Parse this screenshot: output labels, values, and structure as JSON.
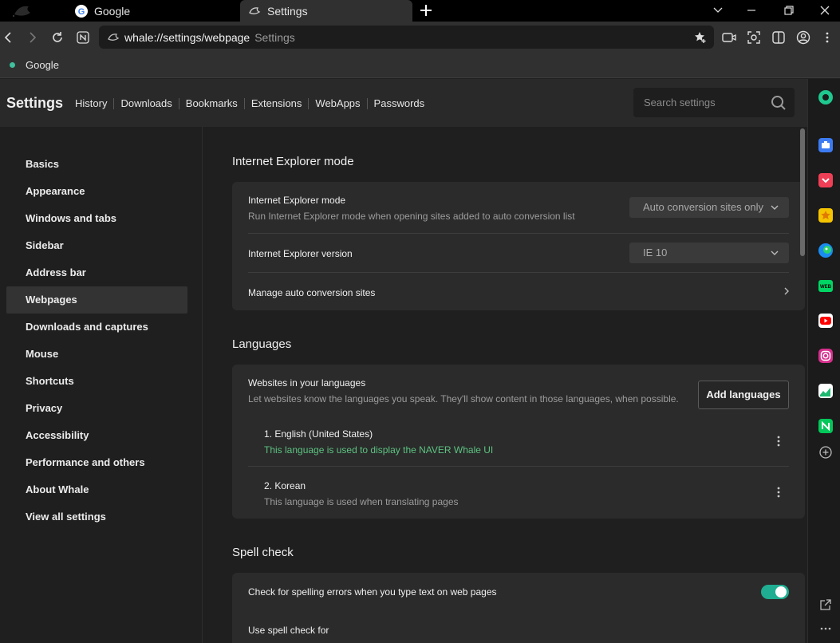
{
  "tabs": [
    {
      "title": "Google",
      "icon": "google-icon"
    },
    {
      "title": "Settings",
      "icon": "whale-icon"
    }
  ],
  "address": {
    "url": "whale://settings/webpage",
    "page_title": "Settings"
  },
  "bookmarks": [
    {
      "label": "Google"
    }
  ],
  "header": {
    "title": "Settings",
    "nav": [
      "History",
      "Downloads",
      "Bookmarks",
      "Extensions",
      "WebApps",
      "Passwords"
    ],
    "search_placeholder": "Search settings"
  },
  "sidebar": {
    "items": [
      "Basics",
      "Appearance",
      "Windows and tabs",
      "Sidebar",
      "Address bar",
      "Webpages",
      "Downloads and captures",
      "Mouse",
      "Shortcuts",
      "Privacy",
      "Accessibility",
      "Performance and others",
      "About Whale",
      "View all settings"
    ],
    "selected": "Webpages"
  },
  "ie_mode": {
    "section_title": "Internet Explorer mode",
    "mode_label": "Internet Explorer mode",
    "mode_desc": "Run Internet Explorer mode when opening sites added to auto conversion list",
    "mode_value": "Auto conversion sites only",
    "version_label": "Internet Explorer version",
    "version_value": "IE 10",
    "manage_label": "Manage auto conversion sites"
  },
  "languages": {
    "section_title": "Languages",
    "label": "Websites in your languages",
    "desc": "Let websites know the languages you speak. They'll show content in those languages, when possible.",
    "add_button": "Add languages",
    "list": [
      {
        "name": "1. English (United States)",
        "note": "This language is used to display the NAVER Whale UI"
      },
      {
        "name": "2. Korean",
        "note": "This language is used when translating pages"
      }
    ]
  },
  "spell": {
    "section_title": "Spell check",
    "check_label": "Check for spelling errors when you type text on web pages",
    "check_enabled": true,
    "use_for_label": "Use spell check for"
  },
  "colors": {
    "accent": "#1fae92",
    "green_note": "#5cc281"
  },
  "side_panel_icons": [
    "whale-space-icon",
    "briefcase-icon",
    "pocket-icon",
    "star-icon",
    "papago-icon",
    "webtoon-icon",
    "youtube-icon",
    "instagram-icon",
    "stock-icon",
    "naver-icon",
    "add-icon",
    "external-link-icon",
    "more-icon"
  ]
}
